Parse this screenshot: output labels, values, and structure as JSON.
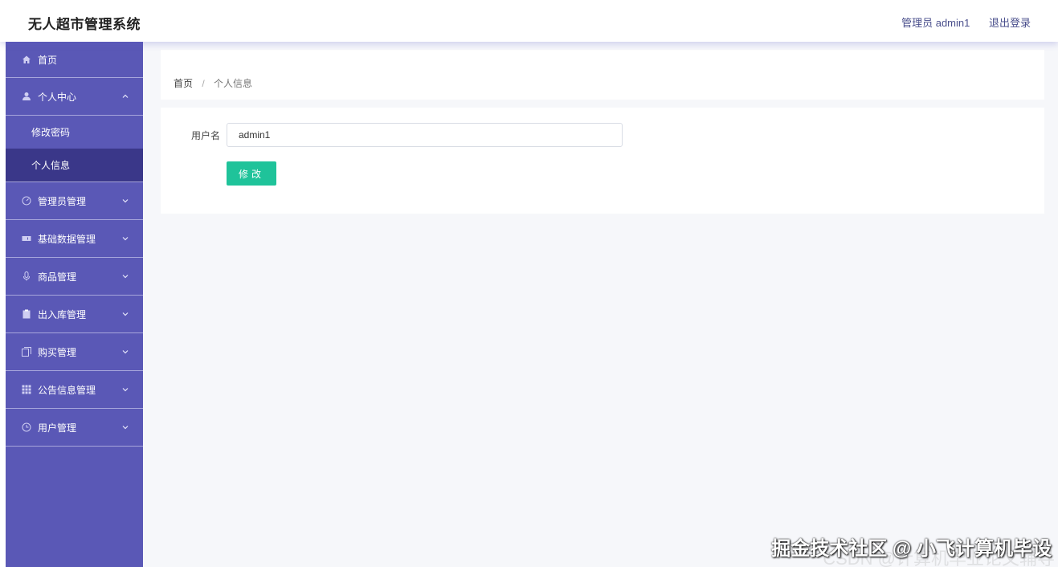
{
  "app": {
    "title": "无人超市管理系统",
    "admin_label": "管理员 admin1",
    "logout_label": "退出登录"
  },
  "sidebar": {
    "items": [
      {
        "label": "首页",
        "icon": "home-icon"
      },
      {
        "label": "个人中心",
        "icon": "user-icon",
        "expanded": true,
        "children": [
          {
            "label": "修改密码"
          },
          {
            "label": "个人信息",
            "active": true
          }
        ]
      },
      {
        "label": "管理员管理",
        "icon": "dashboard-icon"
      },
      {
        "label": "基础数据管理",
        "icon": "ticket-icon"
      },
      {
        "label": "商品管理",
        "icon": "microphone-icon"
      },
      {
        "label": "出入库管理",
        "icon": "clipboard-icon"
      },
      {
        "label": "购买管理",
        "icon": "copy-icon"
      },
      {
        "label": "公告信息管理",
        "icon": "grid-icon"
      },
      {
        "label": "用户管理",
        "icon": "clock-icon"
      }
    ]
  },
  "breadcrumb": {
    "home": "首页",
    "separator": "/",
    "current": "个人信息"
  },
  "form": {
    "username_label": "用户名",
    "username_value": "admin1",
    "submit_label": "修改"
  },
  "watermark": {
    "main": "掘金技术社区 @ 小飞计算机毕设",
    "sub": "CSDN @计算机毕业论文辅导"
  },
  "colors": {
    "sidebar_bg": "#5a58b6",
    "sidebar_active": "#3a3789",
    "button_green": "#1fc39a",
    "main_bg": "#f6f7fa"
  }
}
